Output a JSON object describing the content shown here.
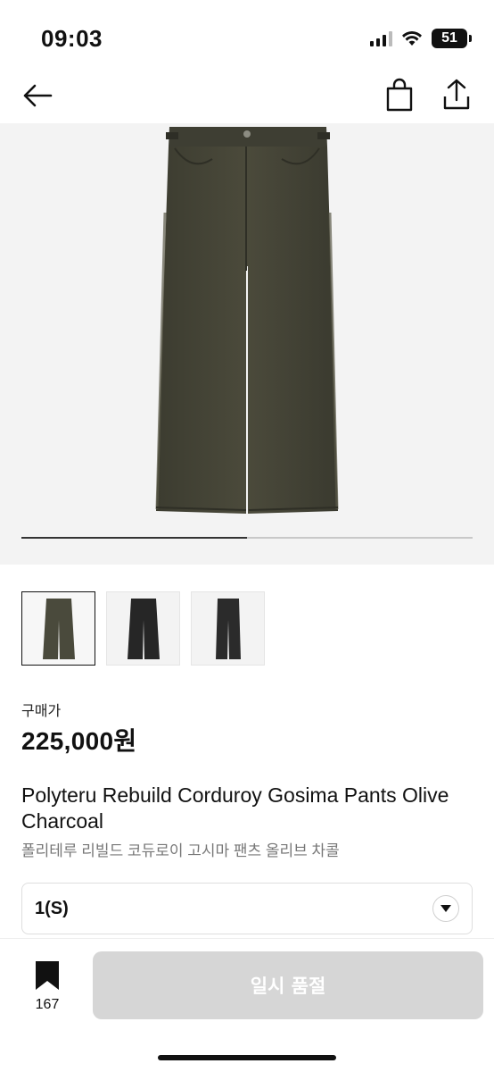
{
  "status_bar": {
    "time": "09:03",
    "battery": "51"
  },
  "nav": {
    "back_icon": "back-arrow-icon",
    "bag_icon": "shopping-bag-icon",
    "share_icon": "share-icon"
  },
  "gallery": {
    "image": "product-image-olive-charcoal-pants",
    "slide_progress": 0.5
  },
  "thumbnails": [
    {
      "label": "olive-charcoal-pants-front",
      "color": "#4a4a3c",
      "selected": true
    },
    {
      "label": "black-pants-front",
      "color": "#262626",
      "selected": false
    },
    {
      "label": "black-pants-front-2",
      "color": "#2b2b2b",
      "selected": false
    }
  ],
  "product": {
    "price_label": "구매가",
    "price": "225,000원",
    "title_en": "Polyteru Rebuild Corduroy Gosima Pants Olive Charcoal",
    "title_ko": "폴리테루 리빌드 코듀로이 고시마 팬츠 올리브 차콜"
  },
  "option": {
    "value": "1(S)"
  },
  "bottom": {
    "bookmark_count": "167",
    "soldout_label": "일시 품절"
  },
  "colors": {
    "accent": "#111111",
    "button_disabled": "#d6d6d6",
    "pants_olive": "#464536"
  }
}
